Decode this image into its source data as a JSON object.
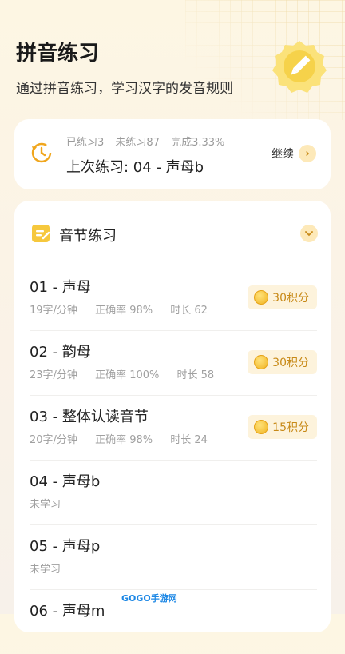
{
  "header": {
    "title": "拼音练习",
    "subtitle": "通过拼音练习，学习汉字的发音规则"
  },
  "progress": {
    "practiced": "已练习3",
    "unpracticed": "未练习87",
    "completed": "完成3.33%",
    "last": "上次练习: 04 - 声母b",
    "continue_label": "继续"
  },
  "section": {
    "title": "音节练习",
    "items": [
      {
        "title": "01 - 声母",
        "speed": "19字/分钟",
        "accuracy": "正确率 98%",
        "duration": "时长 62",
        "points": "30积分"
      },
      {
        "title": "02 - 韵母",
        "speed": "23字/分钟",
        "accuracy": "正确率 100%",
        "duration": "时长 58",
        "points": "30积分"
      },
      {
        "title": "03 - 整体认读音节",
        "speed": "20字/分钟",
        "accuracy": "正确率 98%",
        "duration": "时长 24",
        "points": "15积分"
      },
      {
        "title": "04 - 声母b",
        "status": "未学习"
      },
      {
        "title": "05 - 声母p",
        "status": "未学习"
      },
      {
        "title": "06 - 声母m"
      }
    ]
  },
  "watermark": "GOGO手游网",
  "colors": {
    "accent": "#f5c84b",
    "points_text": "#c88a18",
    "background": "#fbf3e6"
  }
}
